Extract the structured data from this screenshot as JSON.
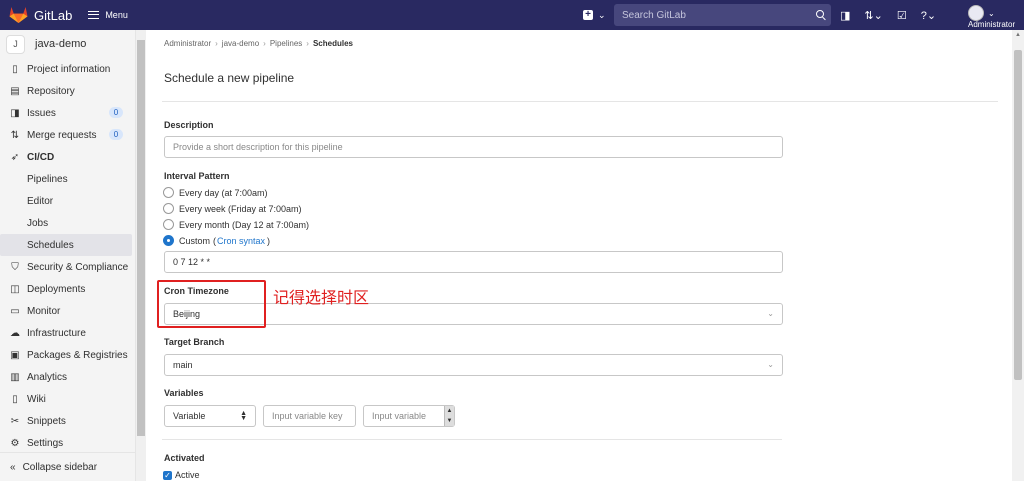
{
  "topbar": {
    "brand": "GitLab",
    "menu_label": "Menu",
    "search_placeholder": "Search GitLab",
    "user_name": "Administrator"
  },
  "sidebar": {
    "project_initial": "J",
    "project_name": "java-demo",
    "items": [
      {
        "label": "Project information",
        "icon": "info-icon"
      },
      {
        "label": "Repository",
        "icon": "repository-icon"
      },
      {
        "label": "Issues",
        "icon": "issues-icon",
        "badge": "0"
      },
      {
        "label": "Merge requests",
        "icon": "merge-request-icon",
        "badge": "0"
      },
      {
        "label": "CI/CD",
        "icon": "rocket-icon"
      },
      {
        "label": "Pipelines"
      },
      {
        "label": "Editor"
      },
      {
        "label": "Jobs"
      },
      {
        "label": "Schedules"
      },
      {
        "label": "Security & Compliance",
        "icon": "shield-icon"
      },
      {
        "label": "Deployments",
        "icon": "deployments-icon"
      },
      {
        "label": "Monitor",
        "icon": "monitor-icon"
      },
      {
        "label": "Infrastructure",
        "icon": "cloud-icon"
      },
      {
        "label": "Packages & Registries",
        "icon": "package-icon"
      },
      {
        "label": "Analytics",
        "icon": "chart-icon"
      },
      {
        "label": "Wiki",
        "icon": "book-icon"
      },
      {
        "label": "Snippets",
        "icon": "scissors-icon"
      },
      {
        "label": "Settings",
        "icon": "gear-icon"
      }
    ],
    "collapse_label": "Collapse sidebar"
  },
  "breadcrumb": [
    "Administrator",
    "java-demo",
    "Pipelines",
    "Schedules"
  ],
  "page_title": "Schedule a new pipeline",
  "form": {
    "description_label": "Description",
    "description_placeholder": "Provide a short description for this pipeline",
    "interval_label": "Interval Pattern",
    "interval_options": [
      "Every day (at 7:00am)",
      "Every week (Friday at 7:00am)",
      "Every month (Day 12 at 7:00am)"
    ],
    "custom_label": "Custom",
    "custom_open": "(",
    "custom_link": "Cron syntax",
    "custom_close": ")",
    "cron_value": "0 7 12 * *",
    "timezone_label": "Cron Timezone",
    "timezone_value": "Beijing",
    "branch_label": "Target Branch",
    "branch_value": "main",
    "variables_label": "Variables",
    "variable_type": "Variable",
    "variable_key_placeholder": "Input variable key",
    "variable_value_placeholder": "Input variable",
    "activated_label": "Activated",
    "active_label": "Active"
  },
  "annotation": {
    "text": "记得选择时区",
    "color": "#e02020"
  },
  "colors": {
    "topbar": "#292961",
    "accent": "#1f75cb"
  }
}
